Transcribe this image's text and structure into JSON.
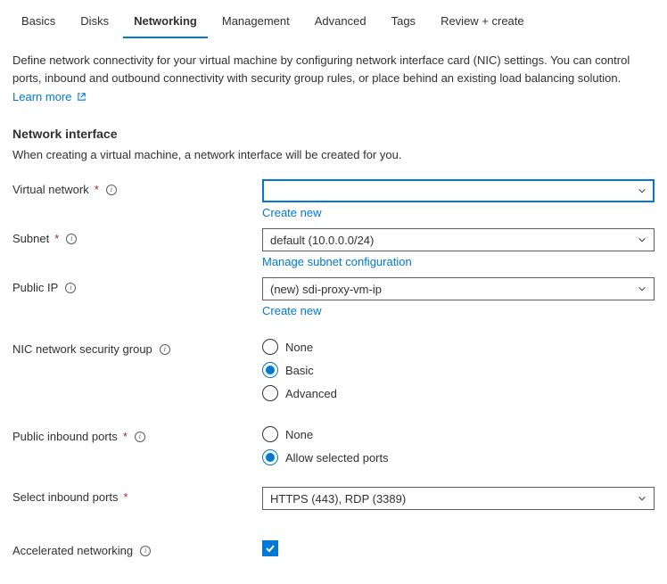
{
  "tabs": {
    "basics": "Basics",
    "disks": "Disks",
    "networking": "Networking",
    "management": "Management",
    "advanced": "Advanced",
    "tags": "Tags",
    "review": "Review + create"
  },
  "intro": {
    "text": "Define network connectivity for your virtual machine by configuring network interface card (NIC) settings. You can control ports, inbound and outbound connectivity with security group rules, or place behind an existing load balancing solution.",
    "learn_more": "Learn more"
  },
  "section": {
    "title": "Network interface",
    "subtitle": "When creating a virtual machine, a network interface will be created for you."
  },
  "fields": {
    "vnet": {
      "label": "Virtual network",
      "value": "",
      "create_new": "Create new"
    },
    "subnet": {
      "label": "Subnet",
      "value": "default (10.0.0.0/24)",
      "manage": "Manage subnet configuration"
    },
    "public_ip": {
      "label": "Public IP",
      "value": "(new) sdi-proxy-vm-ip",
      "create_new": "Create new"
    },
    "nsg": {
      "label": "NIC network security group",
      "options": {
        "none": "None",
        "basic": "Basic",
        "advanced": "Advanced"
      },
      "selected": "basic"
    },
    "inbound": {
      "label": "Public inbound ports",
      "options": {
        "none": "None",
        "allow": "Allow selected ports"
      },
      "selected": "allow"
    },
    "select_ports": {
      "label": "Select inbound ports",
      "value": "HTTPS (443), RDP (3389)"
    },
    "accel_net": {
      "label": "Accelerated networking",
      "checked": true
    }
  }
}
